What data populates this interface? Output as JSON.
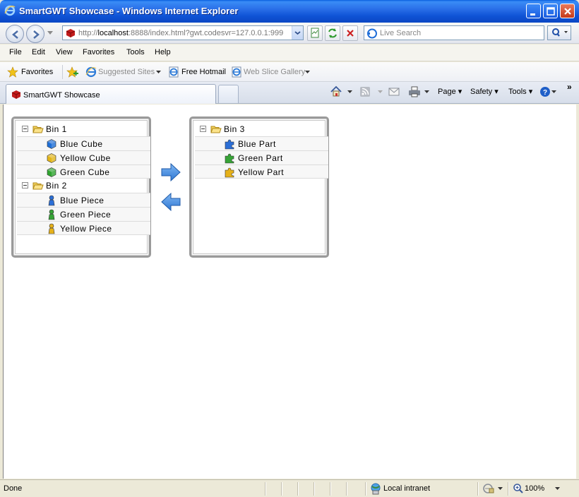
{
  "window": {
    "title": "SmartGWT Showcase - Windows Internet Explorer"
  },
  "address": {
    "prefix": "http://",
    "host": "localhost",
    "rest": ":8888/index.html?gwt.codesvr=127.0.0.1:999",
    "search_placeholder": "Live Search"
  },
  "menu": {
    "items": [
      "File",
      "Edit",
      "View",
      "Favorites",
      "Tools",
      "Help"
    ]
  },
  "favorites": {
    "label": "Favorites",
    "items": [
      "Suggested Sites",
      "Free Hotmail",
      "Web Slice Gallery"
    ]
  },
  "tabs": {
    "active_label": "SmartGWT Showcase"
  },
  "commandbar": {
    "page": "Page",
    "safety": "Safety",
    "tools": "Tools",
    "overflow": "»"
  },
  "left_tree": {
    "nodes": [
      {
        "label": "Bin 1",
        "type": "folder"
      },
      {
        "label": "Blue Cube",
        "type": "cube",
        "color": "#1e6fd8"
      },
      {
        "label": "Yellow Cube",
        "type": "cube",
        "color": "#e4b618"
      },
      {
        "label": "Green Cube",
        "type": "cube",
        "color": "#2fa52f"
      },
      {
        "label": "Bin 2",
        "type": "folder"
      },
      {
        "label": "Blue Piece",
        "type": "piece",
        "color": "#2c6fd6"
      },
      {
        "label": "Green Piece",
        "type": "piece",
        "color": "#36a336"
      },
      {
        "label": "Yellow Piece",
        "type": "piece",
        "color": "#e6b11a"
      }
    ]
  },
  "right_tree": {
    "nodes": [
      {
        "label": "Bin 3",
        "type": "folder"
      },
      {
        "label": "Blue Part",
        "type": "part",
        "color": "#2c6fd6"
      },
      {
        "label": "Green Part",
        "type": "part",
        "color": "#36a336"
      },
      {
        "label": "Yellow Part",
        "type": "part",
        "color": "#e6b11a"
      }
    ]
  },
  "status": {
    "text": "Done",
    "zone": "Local intranet",
    "zoom": "100%"
  },
  "colors": {
    "arrow": "#3b86dd",
    "title_bar": "#0f53d6"
  }
}
